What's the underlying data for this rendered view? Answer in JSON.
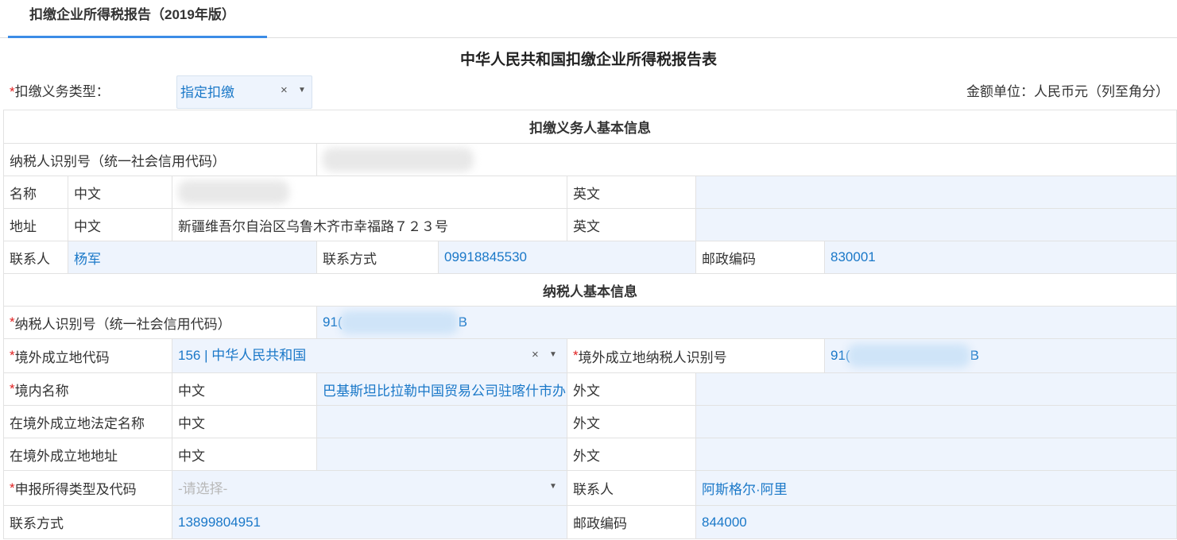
{
  "tab": {
    "label": "扣缴企业所得税报告（2019年版）"
  },
  "form_title": "中华人民共和国扣缴企业所得税报告表",
  "withholding_type": {
    "required": "*",
    "label": "扣缴义务类型：",
    "value": "指定扣缴",
    "clear": "×",
    "arrow": "▼"
  },
  "amount_unit": "金额单位：人民币元（列至角分）",
  "withholder": {
    "header": "扣缴义务人基本信息",
    "taxid_label": "纳税人识别号（统一社会信用代码）",
    "taxid_value_masked": "",
    "name_label": "名称",
    "name_cn_label": "中文",
    "name_cn_value_masked": "",
    "name_en_label": "英文",
    "name_en_value": "",
    "address_label": "地址",
    "address_cn_label": "中文",
    "address_cn_value": "新疆维吾尔自治区乌鲁木齐市幸福路７２３号",
    "address_en_label": "英文",
    "address_en_value": "",
    "contact_label": "联系人",
    "contact_value": "杨军",
    "phone_label": "联系方式",
    "phone_value": "09918845530",
    "zip_label": "邮政编码",
    "zip_value": "830001"
  },
  "taxpayer": {
    "header": "纳税人基本信息",
    "taxid_label": "纳税人识别号（统一社会信用代码）",
    "taxid_prefix": "91(",
    "taxid_suffix": "B",
    "origin_code_label": "境外成立地代码",
    "origin_code_value": "156 | 中华人民共和国",
    "origin_clear": "×",
    "origin_arrow": "▼",
    "foreign_taxid_label": "境外成立地纳税人识别号",
    "foreign_taxid_prefix": "91(",
    "foreign_taxid_suffix": "B",
    "domestic_name_label": "境内名称",
    "domestic_name_cn_label": "中文",
    "domestic_name_cn_value": "巴基斯坦比拉勒中国贸易公司驻喀什市办",
    "domestic_name_foreign_label": "外文",
    "domestic_name_foreign_value": "",
    "legal_name_label": "在境外成立地法定名称",
    "legal_name_cn_label": "中文",
    "legal_name_cn_value": "",
    "legal_name_foreign_label": "外文",
    "legal_name_foreign_value": "",
    "foreign_address_label": "在境外成立地地址",
    "foreign_address_cn_label": "中文",
    "foreign_address_cn_value": "",
    "foreign_address_foreign_label": "外文",
    "foreign_address_foreign_value": "",
    "income_type_label": "申报所得类型及代码",
    "income_type_placeholder": "-请选择-",
    "income_type_arrow": "▼",
    "contact_label": "联系人",
    "contact_value": "阿斯格尔·阿里",
    "phone_label": "联系方式",
    "phone_value": "13899804951",
    "zip_label": "邮政编码",
    "zip_value": "844000"
  },
  "required_mark": "*"
}
